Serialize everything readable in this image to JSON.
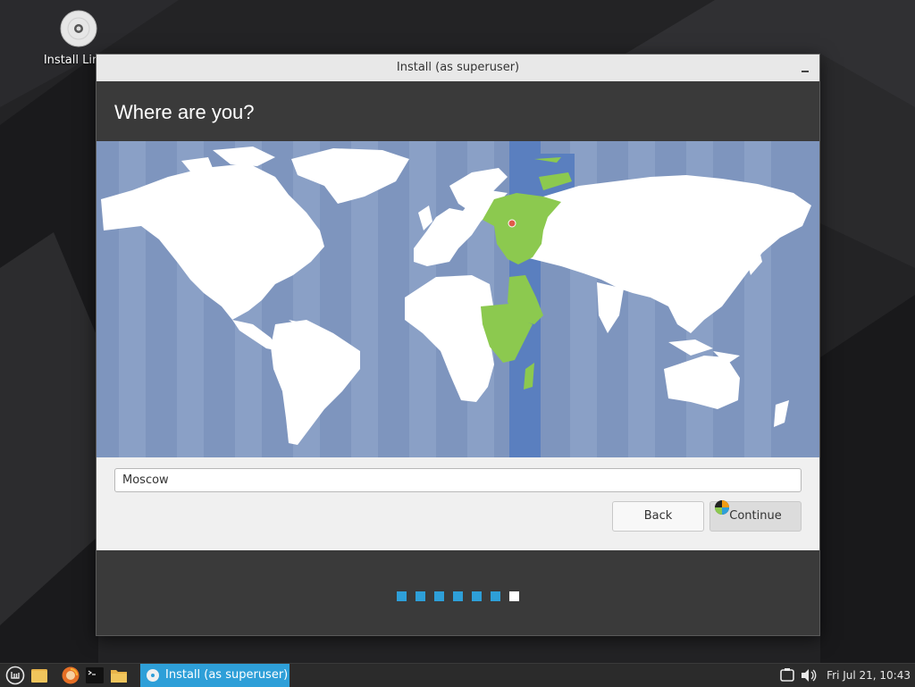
{
  "desktop": {
    "icons": [
      {
        "label": "Install Linux",
        "icon": "disc-icon"
      }
    ]
  },
  "window": {
    "title": "Install (as superuser)",
    "heading": "Where are you?",
    "timezone_map": {
      "selected_city": "Moscow",
      "highlight_color": "#8cc94f",
      "band_color": "#5a7fbf",
      "land_color": "#ffffff",
      "sea_color": "#7e95be"
    },
    "city_field_value": "Moscow",
    "buttons": {
      "back": "Back",
      "continue": "Continue"
    },
    "progress": {
      "total_steps": 7,
      "current_step": 7
    }
  },
  "taskbar": {
    "launchers": [
      "menu-icon",
      "files-icon",
      "firefox-icon",
      "terminal-icon",
      "folder-icon"
    ],
    "active_task": "Install (as superuser)",
    "tray": [
      "network-icon",
      "volume-icon"
    ],
    "clock": "Fri Jul 21, 10:43"
  },
  "colors": {
    "accent": "#2e9fd8",
    "header": "#3a3a3a",
    "panel": "#2b2b2b"
  }
}
